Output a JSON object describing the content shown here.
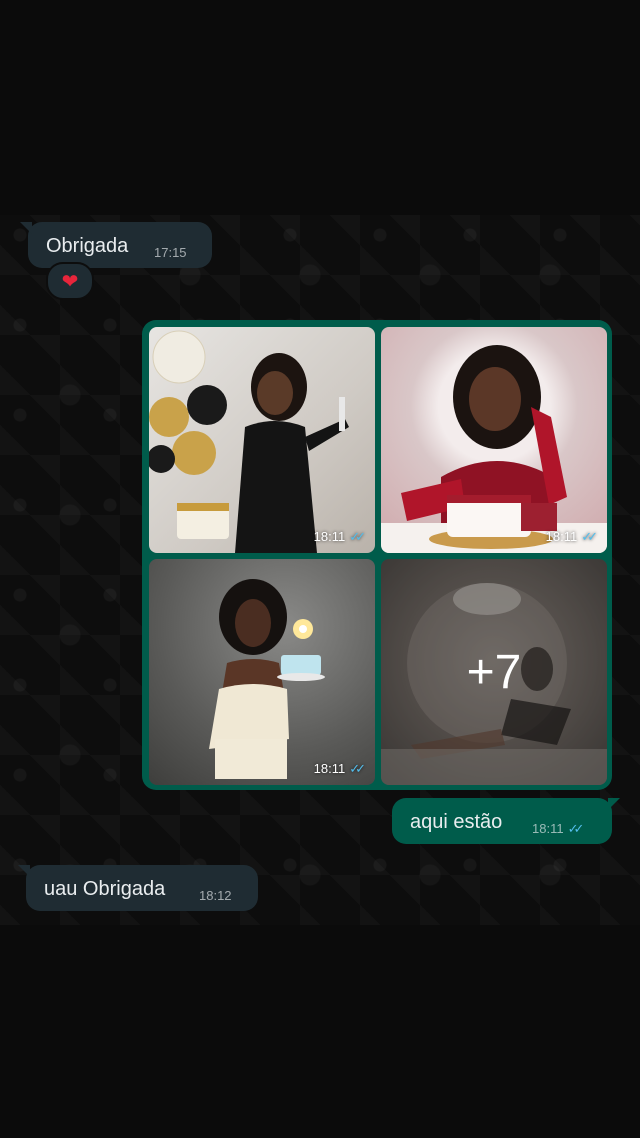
{
  "messages": {
    "m1": {
      "text": "Obrigada",
      "time": "17:15",
      "reaction": "❤"
    },
    "album": {
      "photos": [
        {
          "time": "18:11",
          "status": "read-ticks"
        },
        {
          "time": "18:11",
          "status": "read-ticks"
        },
        {
          "time": "18:11",
          "status": "read-ticks"
        }
      ],
      "more_label": "+7"
    },
    "m2": {
      "text": "aqui estão",
      "time": "18:11",
      "status": "read-ticks"
    },
    "m3": {
      "text": "uau Obrigada",
      "time": "18:12"
    }
  },
  "colors": {
    "incoming_bubble": "#1f2c33",
    "outgoing_bubble": "#005c4b",
    "read_ticks": "#53bdeb",
    "background": "#0b0b0b"
  }
}
